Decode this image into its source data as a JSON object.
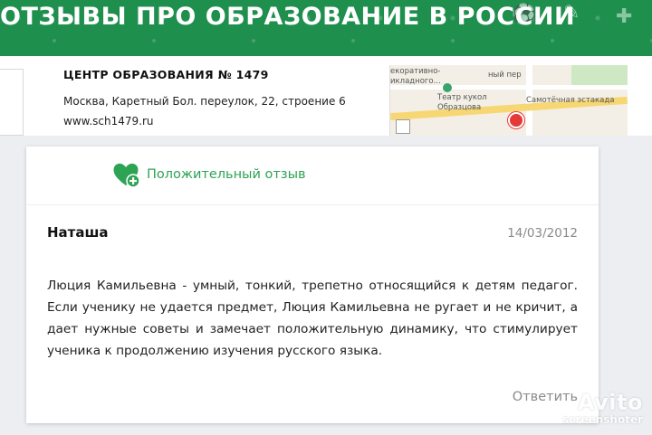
{
  "banner": {
    "title": "ОТЗЫВЫ ПРО ОБРАЗОВАНИЕ В РОССИИ",
    "color": "#1f8f4e"
  },
  "organization": {
    "name": "ЦЕНТР ОБРАЗОВАНИЯ № 1479",
    "address": "Москва, Каретный Бол. переулок, 22, строение 6",
    "website": "www.sch1479.ru"
  },
  "map": {
    "labels": [
      "екоративно-",
      "икладного...",
      "Театр кукол",
      "Образцова",
      "Самотёчная эстакада",
      "ный пер"
    ]
  },
  "review": {
    "sentiment": {
      "label": "Положительный отзыв",
      "icon": "heart-plus-icon",
      "color": "#2da354"
    },
    "author": "Наташа",
    "date": "14/03/2012",
    "text": "Люция Камильевна - умный, тонкий, трепетно относящийся к детям педагог. Если ученику не удается предмет, Люция Камильевна не ругает и не кричит, а дает нужные советы и замечает положительную динамику, что стимулирует ученика к продолжению изучения русского языка.",
    "reply_label": "Ответить"
  },
  "watermark": {
    "brand": "Avito",
    "sub": "screenshoter"
  }
}
